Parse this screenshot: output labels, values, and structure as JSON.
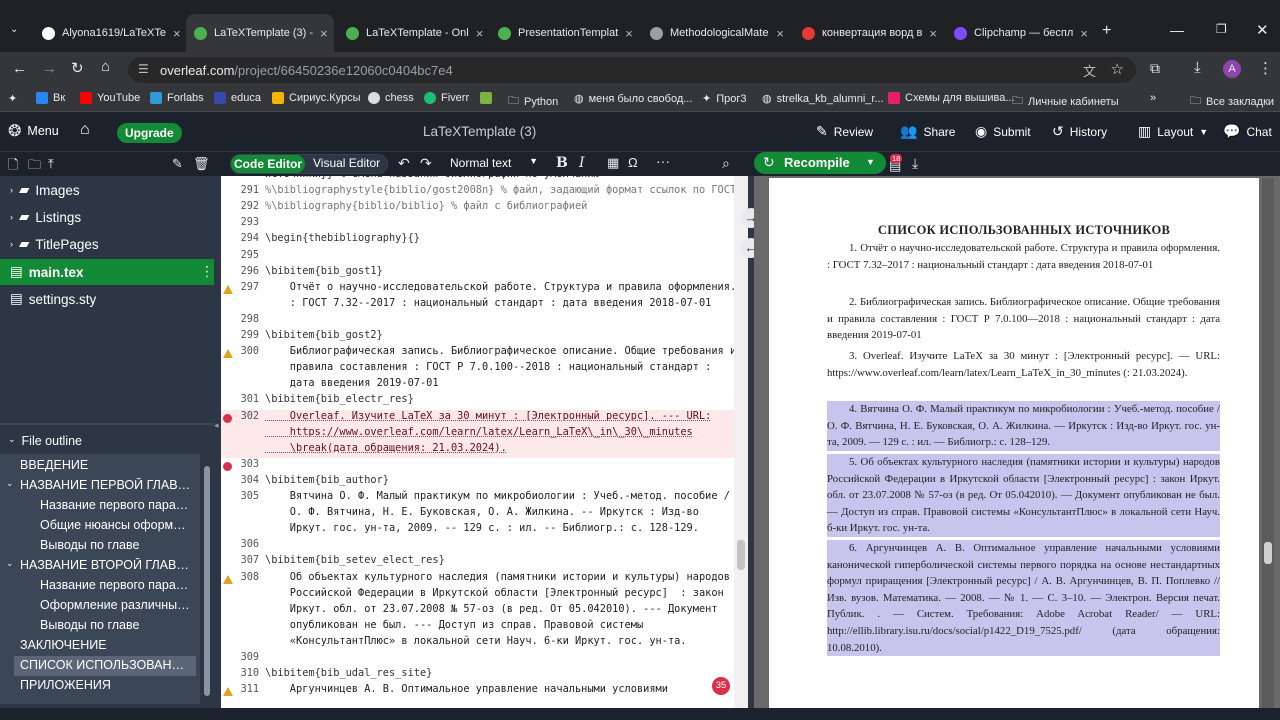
{
  "browser": {
    "tabs": [
      {
        "label": "Alyona1619/LaTeXTe",
        "fav": "#fff"
      },
      {
        "label": "LaTeXTemplate (3) - ",
        "fav": "#4caf50"
      },
      {
        "label": "LaTeXTemplate - Onl",
        "fav": "#4caf50"
      },
      {
        "label": "PresentationTemplat",
        "fav": "#4caf50"
      },
      {
        "label": "MethodologicalMate",
        "fav": "#9aa0a6"
      },
      {
        "label": "конвертация ворд в",
        "fav": "#e53935"
      },
      {
        "label": "Clipchamp — беспл",
        "fav": "#7c4dff"
      }
    ],
    "url_host": "overleaf.com",
    "url_path": "/project/66450236e12060c0404bc7e4",
    "profile": "A",
    "bookmarks": [
      "Вк",
      "YouTube",
      "Forlabs",
      "educa",
      "Сириус.Курсы",
      "chess",
      "Fiverr",
      "",
      "Python",
      "меня было свобод...",
      "Прог3",
      "strelka_kb_alumni_r...",
      "Схемы для вышива...",
      "Личные кабинеты"
    ],
    "all_bookmarks": "Все закладки"
  },
  "overleaf": {
    "menu": "Menu",
    "upgrade": "Upgrade",
    "project_title": "LaTeXTemplate (3)",
    "review": "Review",
    "share": "Share",
    "submit": "Submit",
    "history": "History",
    "layout": "Layout",
    "chat": "Chat",
    "code_editor": "Code Editor",
    "visual_editor": "Visual Editor",
    "normal_text": "Normal text",
    "recompile": "Recompile",
    "log_count": "18"
  },
  "files": [
    "Images",
    "Listings",
    "TitlePages",
    "main.tex",
    "settings.sty"
  ],
  "outline": {
    "title": "File outline",
    "items": [
      "ВВЕДЕНИЕ",
      "НАЗВАНИЕ ПЕРВОЙ ГЛАВЫ ...",
      "Название первого парагр...",
      "Общие нюансы оформле...",
      "Выводы по главе",
      "НАЗВАНИЕ ВТОРОЙ ГЛАВЫ ...",
      "Название первого парагр...",
      "Оформление различных ...",
      "Выводы по главе",
      "ЗАКЛЮЧЕНИЕ",
      "СПИСОК ИСПОЛЬЗОВАННЫ...",
      "ПРИЛОЖЕНИЯ"
    ]
  },
  "editor": {
    "lines": [
      {
        "n": "",
        "t": "источники}} % смена названия библиографии по умолчанию"
      },
      {
        "n": "291",
        "t": "%\\bibliographystyle{biblio/gost2008n} % файл, задающий формат ссылок по ГОСТ"
      },
      {
        "n": "292",
        "t": "%\\bibliography{biblio/biblio} % файл с библиографией"
      },
      {
        "n": "293",
        "t": ""
      },
      {
        "n": "294",
        "t": "\\begin{thebibliography}{}"
      },
      {
        "n": "295",
        "t": ""
      },
      {
        "n": "296",
        "t": "\\bibitem{bib_gost1}"
      },
      {
        "n": "297",
        "t": "    Отчёт о научно-исследовательской работе. Структура и правила оформления."
      },
      {
        "n": "",
        "t": "    : ГОСТ 7.32--2017 : национальный стандарт : дата введения 2018-07-01"
      },
      {
        "n": "298",
        "t": ""
      },
      {
        "n": "299",
        "t": "\\bibitem{bib_gost2}"
      },
      {
        "n": "300",
        "t": "    Библиографическая запись. Библиографическое описание. Общие требования и"
      },
      {
        "n": "",
        "t": "    правила составления : ГОСТ Р 7.0.100--2018 : национальный стандарт :"
      },
      {
        "n": "",
        "t": "    дата введения 2019-07-01"
      },
      {
        "n": "301",
        "t": "\\bibitem{bib_electr_res}"
      },
      {
        "n": "302",
        "t": "    Overleaf. Изучите LaTeX за 30 минут : [Электронный ресурс]. --- URL:"
      },
      {
        "n": "",
        "t": "    https://www.overleaf.com/learn/latex/Learn_LaTeX\\_in\\_30\\_minutes"
      },
      {
        "n": "",
        "t": "    \\break(дата обращения: 21.03.2024)."
      },
      {
        "n": "303",
        "t": ""
      },
      {
        "n": "304",
        "t": "\\bibitem{bib_author}"
      },
      {
        "n": "305",
        "t": "    Вятчина О. Ф. Малый практикум по микробиологии : Учеб.-метод. пособие /"
      },
      {
        "n": "",
        "t": "    О. Ф. Вятчина, Н. Е. Буковская, О. А. Жилкина. -- Иркутск : Изд-во"
      },
      {
        "n": "",
        "t": "    Иркут. гос. ун-та, 2009. -- 129 с. : ил. -- Библиогр.: с. 128-129."
      },
      {
        "n": "306",
        "t": ""
      },
      {
        "n": "307",
        "t": "\\bibitem{bib_setev_elect_res}"
      },
      {
        "n": "308",
        "t": "    Об объектах культурного наследия (памятники истории и культуры) народов"
      },
      {
        "n": "",
        "t": "    Российской Федерации в Иркутской области [Электронный ресурс]  : закон"
      },
      {
        "n": "",
        "t": "    Иркут. обл. от 23.07.2008 № 57-оз (в ред. От 05.042010). --- Документ"
      },
      {
        "n": "",
        "t": "    опубликован не был. --- Доступ из справ. Правовой системы"
      },
      {
        "n": "",
        "t": "    «КонсультантПлюс» в локальной сети Науч. 6-ки Иркут. гос. ун-та."
      },
      {
        "n": "309",
        "t": ""
      },
      {
        "n": "310",
        "t": "\\bibitem{bib_udal_res_site}"
      },
      {
        "n": "311",
        "t": "    Аргунчинцев А. В. Оптимальное управление начальными условиями"
      }
    ],
    "badge": "35"
  },
  "pdf": {
    "heading": "СПИСОК ИСПОЛЬЗОВАННЫХ ИСТОЧНИКОВ",
    "refs": [
      "1. Отчёт о научно-исследовательской работе. Структура и правила оформления. : ГОСТ 7.32–2017 : национальный стандарт : дата введения 2018-07-01",
      "2. Библиографическая запись. Библиографическое описание. Общие требования и правила составления : ГОСТ Р 7.0.100—2018 : национальный стандарт : дата введения 2019-07-01",
      "3. Overleaf. Изучите LaTeX за 30 минут : [Электронный ресурс]. — URL: https://www.overleaf.com/learn/latex/Learn_LaTeX_in_30_minutes (: 21.03.2024).",
      "4. Вятчина О. Ф. Малый практикум по микробиологии : Учеб.-метод. пособие / О. Ф. Вятчина, Н. Е. Буковская, О. А. Жилкина. — Иркутск : Изд-во Иркут. гос. ун-та, 2009. — 129 с. : ил. — Библиогр.: с. 128–129.",
      "5. Об объектах культурного наследия (памятники истории и культуры) народов Российской Федерации в Иркутской области [Электронный ресурс] : закон Иркут. обл. от 23.07.2008 № 57-оз (в ред. От 05.042010). — Документ опубликован не был. — Доступ из справ. Правовой системы «КонсультантПлюс» в локальной сети Науч. б-ки Иркут. гос. ун-та.",
      "6. Аргунчинцев А. В. Оптимальное управление начальными условиями канонической гиперболической системы первого порядка на основе нестандартных формул приращения [Электронный ресурс] / А. В. Аргунчинцев, В. П. Поплевко // Изв. вузов. Математика. — 2008. — № 1. — С. 3–10. — Электрон. Версия печат. Публик. . — Систем. Требования: Adobe Acrobat Reader/ — URL: http://ellib.library.isu.ru/docs/social/p1422_D19_7525.pdf/ (дата обращения: 10.08.2010)."
    ]
  }
}
